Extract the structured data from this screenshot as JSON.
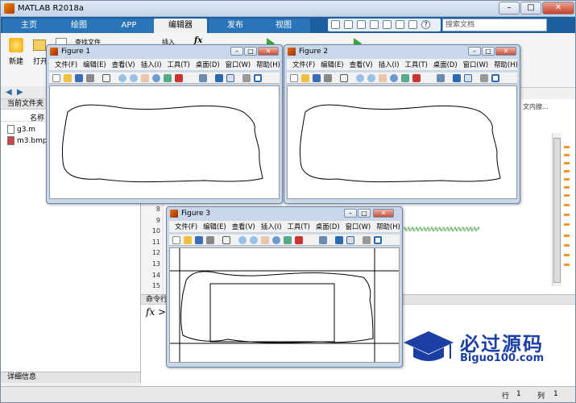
{
  "app": {
    "title": "MATLAB R2018a"
  },
  "tabs": [
    {
      "label": "主页",
      "active": false
    },
    {
      "label": "绘图",
      "active": false
    },
    {
      "label": "APP",
      "active": false
    },
    {
      "label": "编辑器",
      "active": true
    },
    {
      "label": "发布",
      "active": false
    },
    {
      "label": "视图",
      "active": false
    }
  ],
  "search": {
    "placeholder": "搜索文档"
  },
  "ribbon": {
    "new_label": "新建",
    "open_label": "打开",
    "find_files_label": "查找文件",
    "insert_label": "插入",
    "fx_label": "fx"
  },
  "left_panel": {
    "title": "当前文件夹",
    "col_name": "名称",
    "files": [
      "g3.m",
      "m3.bmp"
    ],
    "detail_label": "详细信息"
  },
  "editor": {
    "line_numbers": [
      "8",
      "9",
      "10",
      "11",
      "12",
      "13",
      "14",
      "15"
    ],
    "line10_comment": "%%%%%%%%%%%%%%%%%%%%%%%%%%%%%%%%%%",
    "right_snippet": "文内搜..."
  },
  "command_window": {
    "title": "命令行",
    "prompt": "fx >>"
  },
  "status": {
    "row_label": "行",
    "row_value": "1",
    "col_label": "列",
    "col_value": "1"
  },
  "figures": [
    {
      "title": "Figure 1"
    },
    {
      "title": "Figure 2"
    },
    {
      "title": "Figure 3"
    }
  ],
  "figure_menu": [
    "文件(F)",
    "编辑(E)",
    "查看(V)",
    "插入(I)",
    "工具(T)",
    "桌面(D)",
    "窗口(W)",
    "帮助(H)"
  ],
  "watermark": {
    "zh": "必过源码",
    "en": "Biguo100.com"
  }
}
